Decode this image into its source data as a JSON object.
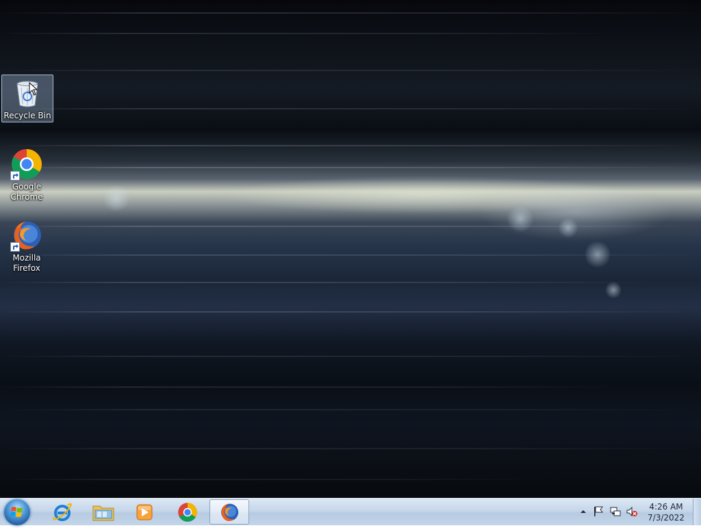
{
  "desktop": {
    "icons": [
      {
        "label": "Recycle Bin",
        "icon": "recycle-bin-icon",
        "selected": true
      },
      {
        "label": "Google Chrome",
        "icon": "chrome-icon",
        "shortcut": true
      },
      {
        "label": "Mozilla Firefox",
        "icon": "firefox-icon",
        "shortcut": true
      }
    ]
  },
  "taskbar": {
    "start_icon": "windows-start-icon",
    "pinned": [
      {
        "icon": "internet-explorer-icon"
      },
      {
        "icon": "file-explorer-icon"
      },
      {
        "icon": "media-player-icon"
      },
      {
        "icon": "chrome-icon"
      },
      {
        "icon": "firefox-icon",
        "active": true
      }
    ],
    "tray": {
      "icons": [
        "show-hidden-icons-chevron",
        "action-center-flag-icon",
        "network-icon",
        "volume-muted-icon"
      ],
      "time": "4:26 AM",
      "date": "7/3/2022"
    }
  },
  "colors": {
    "taskbar": "#c6d7ea",
    "selection": "#aac3e1",
    "text_on_desktop": "#ffffff"
  }
}
